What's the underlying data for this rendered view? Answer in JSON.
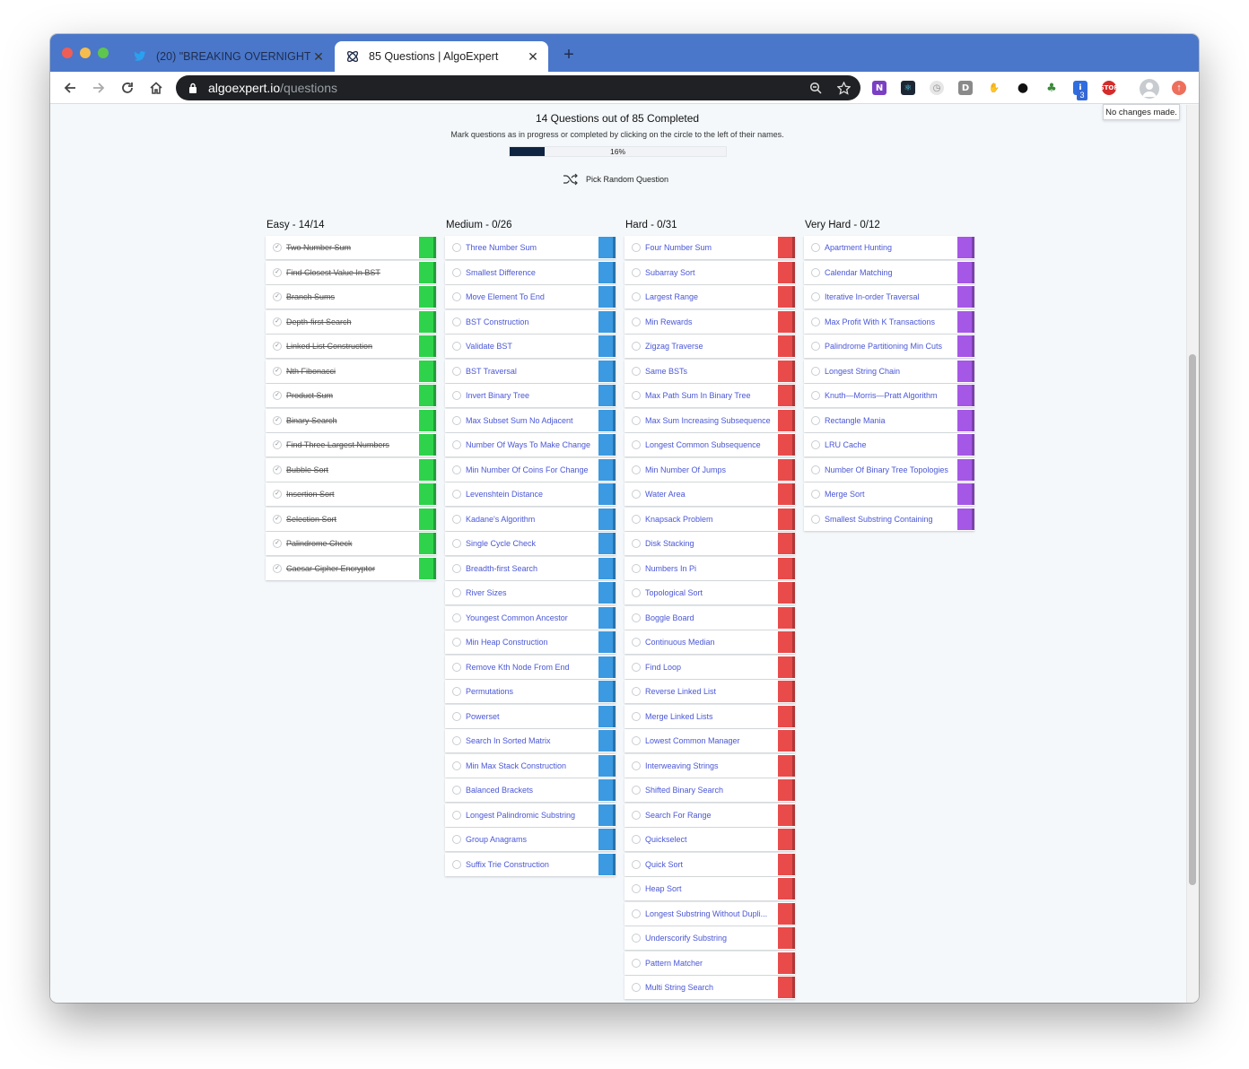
{
  "browser": {
    "tabs": [
      {
        "title": "(20) \"BREAKING OVERNIGHT\" -",
        "favicon": "twitter-icon",
        "active": false
      },
      {
        "title": "85 Questions | AlgoExpert",
        "favicon": "algoexpert-icon",
        "active": true
      }
    ],
    "url_host": "algoexpert.io",
    "url_path": "/questions",
    "extension_badge": "3",
    "tooltip": "No changes made."
  },
  "summary": {
    "title": "14 Questions out of 85 Completed",
    "subtitle": "Mark questions as in progress or completed by clicking on the circle to the left of their names.",
    "progress_percent": 16,
    "progress_label": "16%",
    "random_label": "Pick Random Question"
  },
  "colors": {
    "easy": "#2ed34b",
    "medium": "#3b9ae1",
    "hard": "#e94b4b",
    "very_hard": "#a557e6",
    "link": "#4a57d6"
  },
  "columns": [
    {
      "title": "Easy - 14/14",
      "color": "#2ed34b",
      "done": true,
      "questions": [
        "Two Number Sum",
        "Find Closest Value In BST",
        "Branch Sums",
        "Depth-first Search",
        "Linked List Construction",
        "Nth Fibonacci",
        "Product Sum",
        "Binary Search",
        "Find Three Largest Numbers",
        "Bubble Sort",
        "Insertion Sort",
        "Selection Sort",
        "Palindrome Check",
        "Caesar Cipher Encryptor"
      ]
    },
    {
      "title": "Medium - 0/26",
      "color": "#3b9ae1",
      "done": false,
      "questions": [
        "Three Number Sum",
        "Smallest Difference",
        "Move Element To End",
        "BST Construction",
        "Validate BST",
        "BST Traversal",
        "Invert Binary Tree",
        "Max Subset Sum No Adjacent",
        "Number Of Ways To Make Change",
        "Min Number Of Coins For Change",
        "Levenshtein Distance",
        "Kadane's Algorithm",
        "Single Cycle Check",
        "Breadth-first Search",
        "River Sizes",
        "Youngest Common Ancestor",
        "Min Heap Construction",
        "Remove Kth Node From End",
        "Permutations",
        "Powerset",
        "Search In Sorted Matrix",
        "Min Max Stack Construction",
        "Balanced Brackets",
        "Longest Palindromic Substring",
        "Group Anagrams",
        "Suffix Trie Construction"
      ]
    },
    {
      "title": "Hard - 0/31",
      "color": "#e94b4b",
      "done": false,
      "questions": [
        "Four Number Sum",
        "Subarray Sort",
        "Largest Range",
        "Min Rewards",
        "Zigzag Traverse",
        "Same BSTs",
        "Max Path Sum In Binary Tree",
        "Max Sum Increasing Subsequence",
        "Longest Common Subsequence",
        "Min Number Of Jumps",
        "Water Area",
        "Knapsack Problem",
        "Disk Stacking",
        "Numbers In Pi",
        "Topological Sort",
        "Boggle Board",
        "Continuous Median",
        "Find Loop",
        "Reverse Linked List",
        "Merge Linked Lists",
        "Lowest Common Manager",
        "Interweaving Strings",
        "Shifted Binary Search",
        "Search For Range",
        "Quickselect",
        "Quick Sort",
        "Heap Sort",
        "Longest Substring Without Dupli...",
        "Underscorify Substring",
        "Pattern Matcher",
        "Multi String Search"
      ]
    },
    {
      "title": "Very Hard - 0/12",
      "color": "#a557e6",
      "done": false,
      "questions": [
        "Apartment Hunting",
        "Calendar Matching",
        "Iterative In-order Traversal",
        "Max Profit With K Transactions",
        "Palindrome Partitioning Min Cuts",
        "Longest String Chain",
        "Knuth—Morris—Pratt Algorithm",
        "Rectangle Mania",
        "LRU Cache",
        "Number Of Binary Tree Topologies",
        "Merge Sort",
        "Smallest Substring Containing"
      ]
    }
  ]
}
